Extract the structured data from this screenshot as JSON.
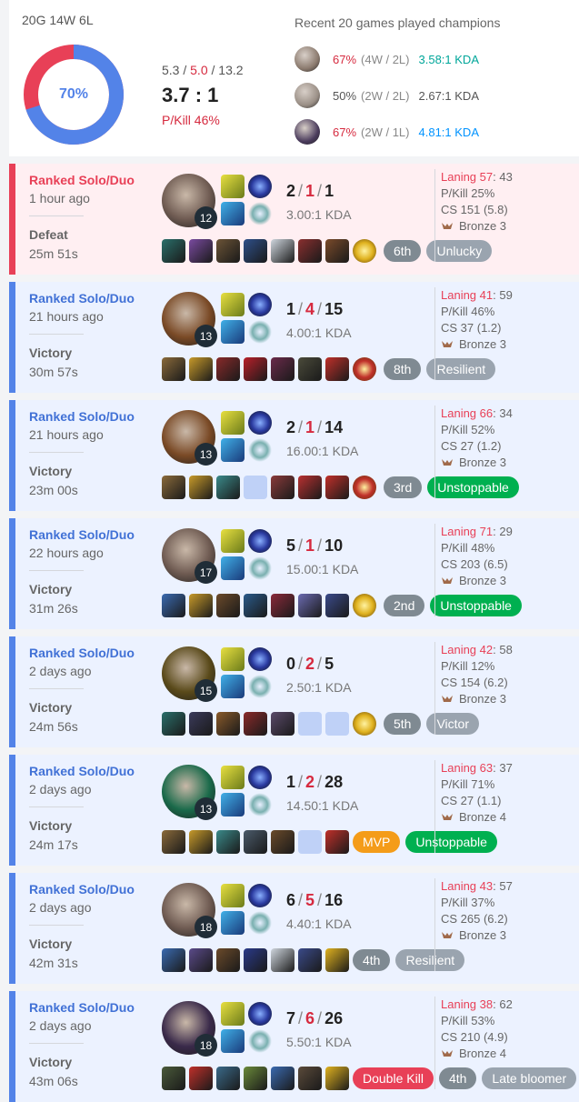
{
  "summary": {
    "record": "20G 14W 6L",
    "winrate_label": "70%",
    "winrate": 0.7,
    "kills": "5.3",
    "deaths": "5.0",
    "assists": "13.2",
    "kda_ratio": "3.7 : 1",
    "pkill": "P/Kill 46%",
    "recent_title": "Recent 20 games played champions",
    "champions": [
      {
        "icon": "champion-portrait-icon",
        "color": "#8b7a6e",
        "winrate": "67%",
        "wl": "(4W / 2L)",
        "kda": "3.58:1 KDA",
        "kda_style": "teal",
        "wr_style": "red"
      },
      {
        "icon": "champion-portrait-icon",
        "color": "#9a8f86",
        "winrate": "50%",
        "wl": "(2W / 2L)",
        "kda": "2.67:1 KDA",
        "kda_style": "plain",
        "wr_style": "neutral"
      },
      {
        "icon": "champion-portrait-icon",
        "color": "#4a3b5c",
        "winrate": "67%",
        "wl": "(2W / 1L)",
        "kda": "4.81:1 KDA",
        "kda_style": "blue",
        "wr_style": "red"
      }
    ]
  },
  "matches": [
    {
      "type": "Ranked Solo/Duo",
      "ago": "1 hour ago",
      "result": "Defeat",
      "duration": "25m 51s",
      "outcome": "loss",
      "level": "12",
      "kills": "2",
      "deaths": "1",
      "assists": "1",
      "kda": "3.00:1 KDA",
      "laning": "Laning 57",
      "laning_opp": ": 43",
      "pkill": "P/Kill 25%",
      "cs": "CS 151 (5.8)",
      "rank": "Bronze 3",
      "champ_color": "#6f5b52",
      "items": [
        "#2a6f6a",
        "#7a4aa0",
        "#6b5336",
        "#2e4f8a",
        "#cfd6de",
        "#8a2f2f",
        "#7a4a2a"
      ],
      "ward": "#e0b21f",
      "badges": [
        {
          "text": "6th",
          "style": "b-place"
        },
        {
          "text": "Unlucky",
          "style": "b-gray"
        }
      ]
    },
    {
      "type": "Ranked Solo/Duo",
      "ago": "21 hours ago",
      "result": "Victory",
      "duration": "30m 57s",
      "outcome": "win",
      "level": "13",
      "kills": "1",
      "deaths": "4",
      "assists": "15",
      "kda": "4.00:1 KDA",
      "laning": "Laning 41",
      "laning_opp": ": 59",
      "pkill": "P/Kill 46%",
      "cs": "CS 37 (1.2)",
      "rank": "Bronze 3",
      "champ_color": "#7a4a26",
      "items": [
        "#8a6a3a",
        "#c79a2a",
        "#8a2a2a",
        "#b8202a",
        "#6a2a4a",
        "#4a4a3a",
        "#c0302a"
      ],
      "ward": "#c0302a",
      "badges": [
        {
          "text": "8th",
          "style": "b-place"
        },
        {
          "text": "Resilient",
          "style": "b-gray"
        }
      ]
    },
    {
      "type": "Ranked Solo/Duo",
      "ago": "21 hours ago",
      "result": "Victory",
      "duration": "23m 00s",
      "outcome": "win",
      "level": "13",
      "kills": "2",
      "deaths": "1",
      "assists": "14",
      "kda": "16.00:1 KDA",
      "laning": "Laning 66",
      "laning_opp": ": 34",
      "pkill": "P/Kill 52%",
      "cs": "CS 27 (1.2)",
      "rank": "Bronze 3",
      "champ_color": "#7a4a26",
      "items": [
        "#8a6a3a",
        "#c79a2a",
        "#3a8a8a",
        "empty",
        "#8a3a3a",
        "#b83030",
        "#c0302a"
      ],
      "ward": "#c0302a",
      "badges": [
        {
          "text": "3rd",
          "style": "b-place"
        },
        {
          "text": "Unstoppable",
          "style": "b-green"
        }
      ]
    },
    {
      "type": "Ranked Solo/Duo",
      "ago": "22 hours ago",
      "result": "Victory",
      "duration": "31m 26s",
      "outcome": "win",
      "level": "17",
      "kills": "5",
      "deaths": "1",
      "assists": "10",
      "kda": "15.00:1 KDA",
      "laning": "Laning 71",
      "laning_opp": ": 29",
      "pkill": "P/Kill 48%",
      "cs": "CS 203 (6.5)",
      "rank": "Bronze 3",
      "champ_color": "#6f5b52",
      "items": [
        "#3a6ab0",
        "#c79a2a",
        "#6b4a2a",
        "#2a5a8a",
        "#8a2a3a",
        "#6a6ab0",
        "#3a4a8a"
      ],
      "ward": "#e0b21f",
      "badges": [
        {
          "text": "2nd",
          "style": "b-place"
        },
        {
          "text": "Unstoppable",
          "style": "b-green"
        }
      ]
    },
    {
      "type": "Ranked Solo/Duo",
      "ago": "2 days ago",
      "result": "Victory",
      "duration": "24m 56s",
      "outcome": "win",
      "level": "15",
      "kills": "0",
      "deaths": "2",
      "assists": "5",
      "kda": "2.50:1 KDA",
      "laning": "Laning 42",
      "laning_opp": ": 58",
      "pkill": "P/Kill 12%",
      "cs": "CS 154 (6.2)",
      "rank": "Bronze 3",
      "champ_color": "#5a4a1a",
      "items": [
        "#2a6f6a",
        "#3a3a5a",
        "#8a5a2a",
        "#8a2a2a",
        "#5a4a6a",
        "empty",
        "empty"
      ],
      "ward": "#e0b21f",
      "badges": [
        {
          "text": "5th",
          "style": "b-place"
        },
        {
          "text": "Victor",
          "style": "b-gray"
        }
      ]
    },
    {
      "type": "Ranked Solo/Duo",
      "ago": "2 days ago",
      "result": "Victory",
      "duration": "24m 17s",
      "outcome": "win",
      "level": "13",
      "kills": "1",
      "deaths": "2",
      "assists": "28",
      "kda": "14.50:1 KDA",
      "laning": "Laning 63",
      "laning_opp": ": 37",
      "pkill": "P/Kill 71%",
      "cs": "CS 27 (1.1)",
      "rank": "Bronze 4",
      "champ_color": "#1a6a4a",
      "items": [
        "#8a6a3a",
        "#c79a2a",
        "#3a8a8a",
        "#4a5a6a",
        "#6a4a2a",
        "empty",
        "#c0302a"
      ],
      "ward": "",
      "badges": [
        {
          "text": "MVP",
          "style": "b-orange"
        },
        {
          "text": "Unstoppable",
          "style": "b-green"
        }
      ]
    },
    {
      "type": "Ranked Solo/Duo",
      "ago": "2 days ago",
      "result": "Victory",
      "duration": "42m 31s",
      "outcome": "win",
      "level": "18",
      "kills": "6",
      "deaths": "5",
      "assists": "16",
      "kda": "4.40:1 KDA",
      "laning": "Laning 43",
      "laning_opp": ": 57",
      "pkill": "P/Kill 37%",
      "cs": "CS 265 (6.2)",
      "rank": "Bronze 3",
      "champ_color": "#6f5b52",
      "items": [
        "#3a6ab0",
        "#5a4a8a",
        "#6b4a2a",
        "#2a3a8a",
        "#cfd6de",
        "#3a4a8a",
        "#e0b21f"
      ],
      "ward": "",
      "badges": [
        {
          "text": "4th",
          "style": "b-place"
        },
        {
          "text": "Resilient",
          "style": "b-gray"
        }
      ]
    },
    {
      "type": "Ranked Solo/Duo",
      "ago": "2 days ago",
      "result": "Victory",
      "duration": "43m 06s",
      "outcome": "win",
      "level": "18",
      "kills": "7",
      "deaths": "6",
      "assists": "26",
      "kda": "5.50:1 KDA",
      "laning": "Laning 38",
      "laning_opp": ": 62",
      "pkill": "P/Kill 53%",
      "cs": "CS 210 (4.9)",
      "rank": "Bronze 4",
      "champ_color": "#3a2a4a",
      "items": [
        "#4a5a3a",
        "#c0302a",
        "#3a6a8a",
        "#6a8a3a",
        "#3a6ab0",
        "#5a4a3a",
        "#e0b21f"
      ],
      "ward": "",
      "badges": [
        {
          "text": "Double Kill",
          "style": "b-red"
        },
        {
          "text": "4th",
          "style": "b-place"
        },
        {
          "text": "Late bloomer",
          "style": "b-gray"
        }
      ]
    }
  ]
}
